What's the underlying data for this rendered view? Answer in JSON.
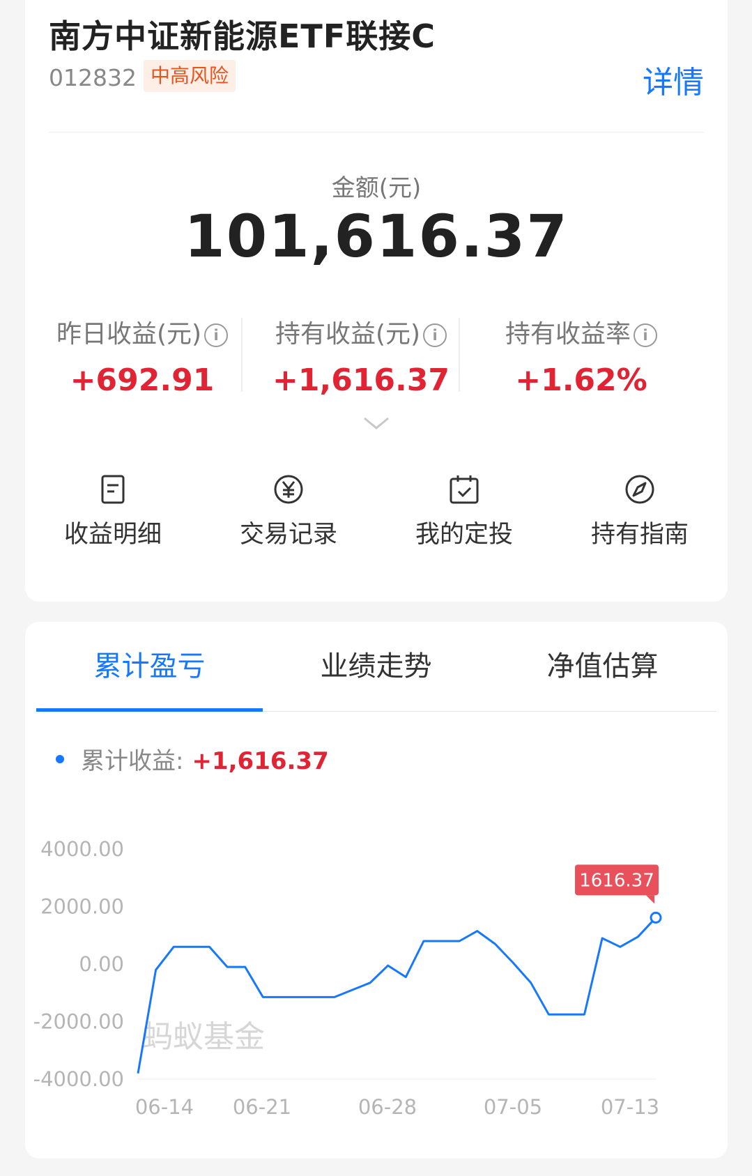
{
  "fund": {
    "name": "南方中证新能源ETF联接C",
    "code": "012832",
    "risk": "中高风险",
    "detail_link": "详情"
  },
  "holding": {
    "amount_label": "金额(元)",
    "amount": "101,616.37",
    "stats": [
      {
        "label": "昨日收益(元)",
        "value": "+692.91"
      },
      {
        "label": "持有收益(元)",
        "value": "+1,616.37"
      },
      {
        "label": "持有收益率",
        "value": "+1.62%"
      }
    ],
    "info_glyph": "i"
  },
  "actions": [
    {
      "label": "收益明细",
      "icon": "document-icon"
    },
    {
      "label": "交易记录",
      "icon": "yuan-icon"
    },
    {
      "label": "我的定投",
      "icon": "calendar-check-icon"
    },
    {
      "label": "持有指南",
      "icon": "compass-icon"
    }
  ],
  "tabs": [
    {
      "label": "累计盈亏",
      "active": true
    },
    {
      "label": "业绩走势",
      "active": false
    },
    {
      "label": "净值估算",
      "active": false
    }
  ],
  "legend": {
    "label": "累计收益:",
    "value": "+1,616.37"
  },
  "watermark": "蚂蚁基金",
  "colors": {
    "accent": "#1677ff",
    "gain": "#e02434",
    "risk": "#e8541e",
    "tooltip": "#e8505b"
  },
  "chart_data": {
    "type": "line",
    "title": "",
    "xlabel": "",
    "ylabel": "",
    "ylim": [
      -4000,
      4000
    ],
    "yticks": [
      "4000.00",
      "2000.00",
      "0.00",
      "-2000.00",
      "-4000.00"
    ],
    "xticks": [
      "06-14",
      "06-21",
      "06-28",
      "07-05",
      "07-13"
    ],
    "tooltip": "1616.37",
    "series": [
      {
        "name": "累计收益",
        "points": [
          {
            "x": "06-13",
            "y": -3800
          },
          {
            "x": "06-14",
            "y": -200
          },
          {
            "x": "06-15",
            "y": 600
          },
          {
            "x": "06-16",
            "y": 600
          },
          {
            "x": "06-17",
            "y": 600
          },
          {
            "x": "06-20",
            "y": -100
          },
          {
            "x": "06-21",
            "y": -100
          },
          {
            "x": "06-22",
            "y": -1150
          },
          {
            "x": "06-23",
            "y": -1150
          },
          {
            "x": "06-24",
            "y": -1150
          },
          {
            "x": "06-27",
            "y": -1150
          },
          {
            "x": "06-28",
            "y": -1150
          },
          {
            "x": "06-29",
            "y": -900
          },
          {
            "x": "06-30",
            "y": -650
          },
          {
            "x": "07-01",
            "y": -50
          },
          {
            "x": "07-04",
            "y": -450
          },
          {
            "x": "07-05",
            "y": 800
          },
          {
            "x": "07-06",
            "y": 800
          },
          {
            "x": "07-07",
            "y": 800
          },
          {
            "x": "07-08",
            "y": 1150
          },
          {
            "x": "07-11",
            "y": 700
          },
          {
            "x": "07-12",
            "y": 50
          },
          {
            "x": "07-13",
            "y": -650
          },
          {
            "x": "07-14",
            "y": -1750
          },
          {
            "x": "07-15",
            "y": -1750
          },
          {
            "x": "07-18",
            "y": -1750
          },
          {
            "x": "07-19",
            "y": 900
          },
          {
            "x": "07-20",
            "y": 600
          },
          {
            "x": "07-21",
            "y": 950
          },
          {
            "x": "07-22",
            "y": 1616.37
          }
        ]
      }
    ]
  }
}
